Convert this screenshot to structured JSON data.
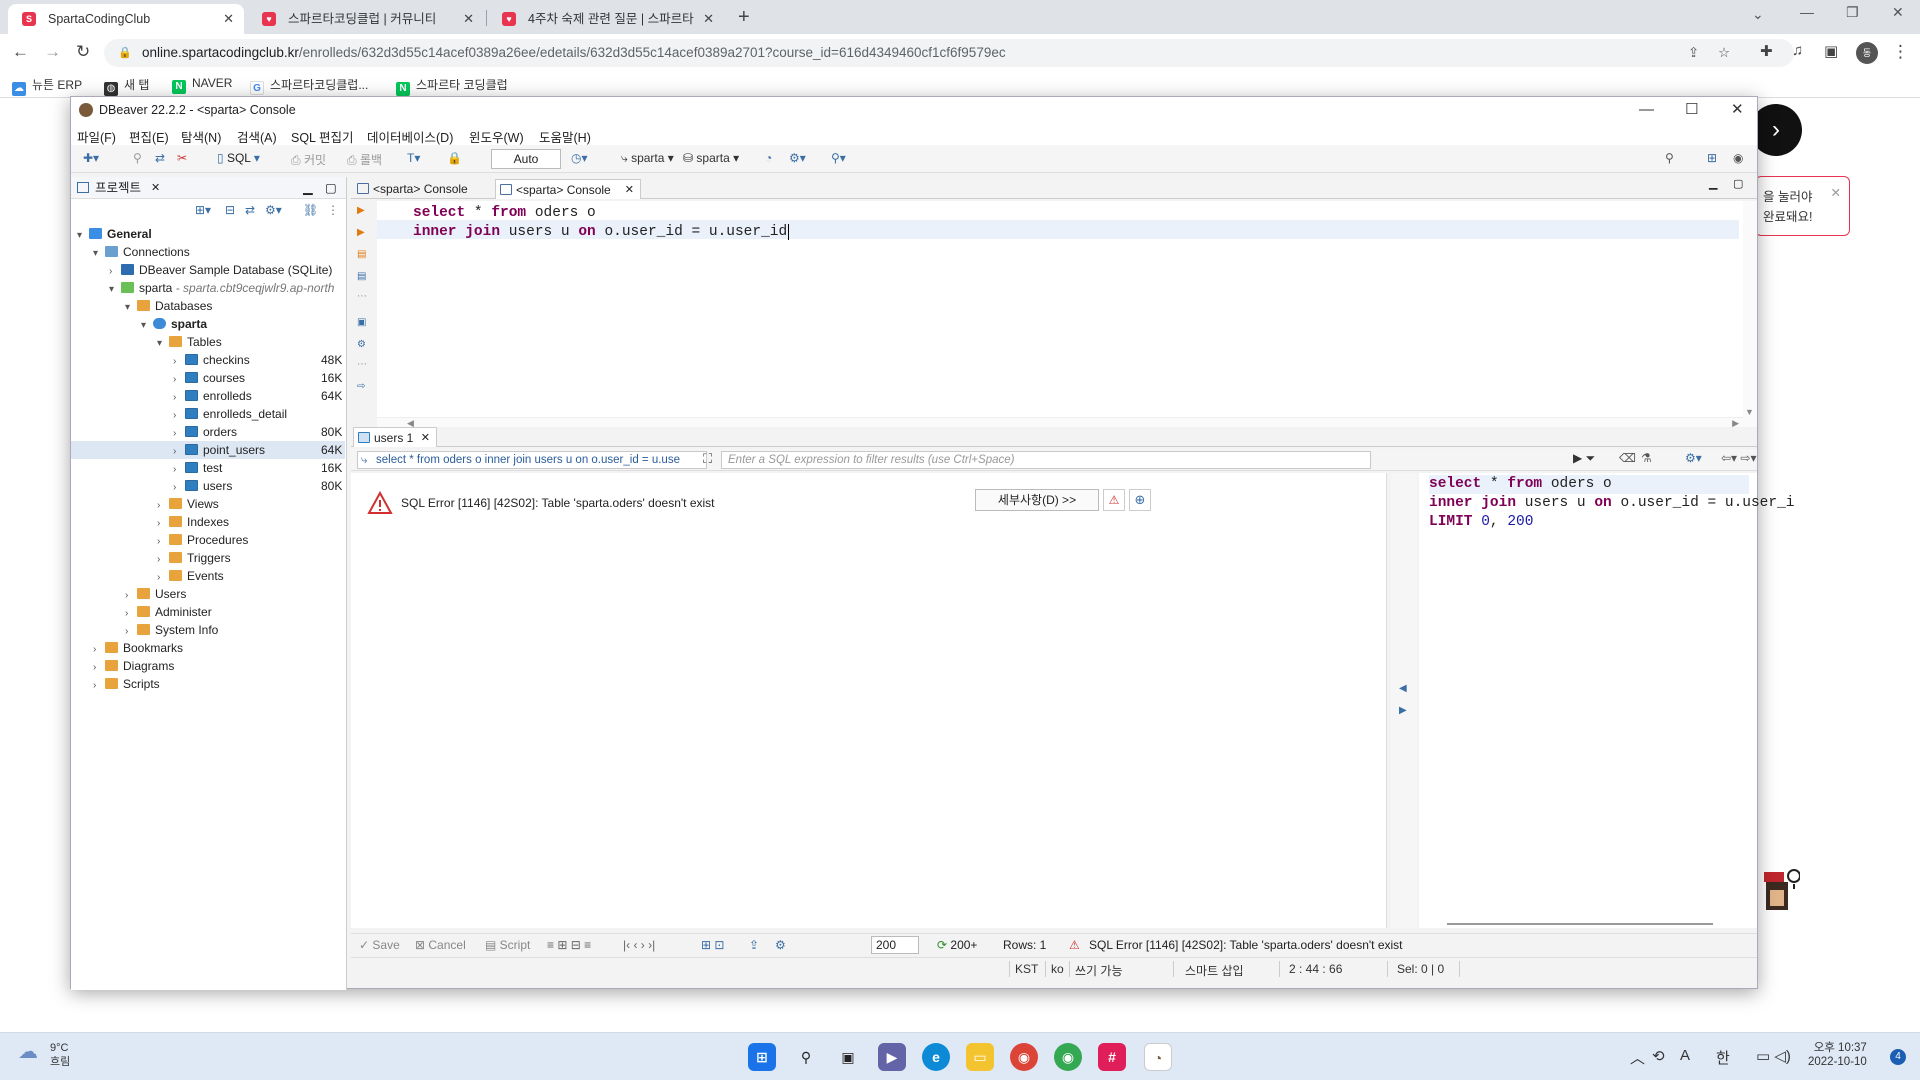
{
  "browser": {
    "tabs": [
      {
        "title": "SpartaCodingClub"
      },
      {
        "title": "스파르타코딩클럽 | 커뮤니티"
      },
      {
        "title": "4주차 숙제 관련 질문 | 스파르타"
      }
    ],
    "url_host": "online.spartacodingclub.kr",
    "url_path": "/enrolleds/632d3d55c14acef0389a26ee/edetails/632d3d55c14acef0389a2701?course_id=616d4349460cf1cf6f9579ec",
    "bookmarks": [
      {
        "label": "뉴튼 ERP"
      },
      {
        "label": "새 탭"
      },
      {
        "label": "NAVER"
      },
      {
        "label": "스파르타코딩클럽..."
      },
      {
        "label": "스파르타 코딩클럽"
      }
    ]
  },
  "page_behind": {
    "toast_line1": "을 눌러야",
    "toast_line2": "완료돼요!"
  },
  "dbeaver": {
    "window_title": "DBeaver 22.2.2 - <sparta> Console",
    "menus": [
      "파일(F)",
      "편집(E)",
      "탐색(N)",
      "검색(A)",
      "SQL 편집기",
      "데이터베이스(D)",
      "윈도우(W)",
      "도움말(H)"
    ],
    "toolbar": {
      "sql": "SQL",
      "commit": "커밋",
      "rollback": "롤백",
      "mode": "Auto",
      "datasource": "sparta",
      "schema": "sparta"
    },
    "project_panel": {
      "title": "프로젝트",
      "tree": {
        "general": "General",
        "connections": "Connections",
        "sample_db": "DBeaver Sample Database (SQLite)",
        "sparta_conn": "sparta",
        "sparta_host": "- sparta.cbt9ceqjwlr9.ap-north",
        "databases": "Databases",
        "sparta_db": "sparta",
        "tables": "Tables",
        "table_items": [
          {
            "name": "checkins",
            "size": "48K"
          },
          {
            "name": "courses",
            "size": "16K"
          },
          {
            "name": "enrolleds",
            "size": "64K"
          },
          {
            "name": "enrolleds_detail",
            "size": ""
          },
          {
            "name": "orders",
            "size": "80K"
          },
          {
            "name": "point_users",
            "size": "64K"
          },
          {
            "name": "test",
            "size": "16K"
          },
          {
            "name": "users",
            "size": "80K"
          }
        ],
        "db_folders": [
          "Views",
          "Indexes",
          "Procedures",
          "Triggers",
          "Events"
        ],
        "conn_folders": [
          "Users",
          "Administer",
          "System Info"
        ],
        "root_folders": [
          "Bookmarks",
          "Diagrams",
          "Scripts"
        ]
      }
    },
    "editor_tabs": [
      "<sparta> Console",
      "<sparta> Console"
    ],
    "sql": {
      "line1": {
        "kw1": "select",
        "t1": " * ",
        "kw2": "from",
        "t2": " oders o"
      },
      "line2": {
        "kw1": "inner join",
        "t1": " users u ",
        "kw2": "on",
        "t2": " o.user_id = u.user_id"
      }
    },
    "results": {
      "tab": "users 1",
      "filter_query": "select * from oders o inner join users u on o.user_id = u.use",
      "filter_hint": "Enter a SQL expression to filter results (use Ctrl+Space)",
      "error_message": "SQL Error [1146] [42S02]: Table 'sparta.oders' doesn't exist",
      "detail_button": "세부사항(D) >>",
      "query_panel": {
        "line1": {
          "kw1": "select",
          "t1": " * ",
          "kw2": "from",
          "t2": " oders o"
        },
        "line2": {
          "kw1": "inner join",
          "t1": " users u ",
          "kw2": "on",
          "t2": " o.user_id = u.user_i"
        },
        "line3": {
          "kw": "LIMIT",
          "n1": "0",
          "sep": ", ",
          "n2": "200"
        }
      }
    },
    "status_row": {
      "save": "Save",
      "cancel": "Cancel",
      "script": "Script",
      "fetch_size": "200",
      "fetch_more": "200+",
      "rows": "Rows: 1",
      "error": "SQL Error [1146] [42S02]: Table 'sparta.oders' doesn't exist"
    },
    "bottom_bar": {
      "tz": "KST",
      "lang": "ko",
      "writable": "쓰기 가능",
      "insert_mode": "스마트 삽입",
      "position": "2 : 44 : 66",
      "selection": "Sel: 0 | 0"
    }
  },
  "taskbar": {
    "weather_temp": "9°C",
    "weather_desc": "흐림",
    "time": "오후 10:37",
    "date": "2022-10-10",
    "ime": "한",
    "notif_count": "4"
  }
}
